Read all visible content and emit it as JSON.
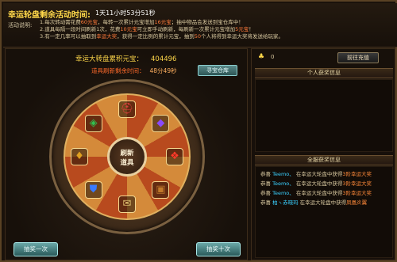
{
  "header": {
    "title": "幸运轮盘剩余活动时间:",
    "countdown": "1天11小时53分51秒",
    "desc_label": "活动说明:",
    "desc_lines": [
      {
        "num": "1.",
        "parts": [
          {
            "t": "每次转动需花费",
            "hl": false
          },
          {
            "t": "60元宝",
            "hl": true
          },
          {
            "t": "，每转一次累计元宝增加",
            "hl": false
          },
          {
            "t": "16元宝",
            "hl": true
          },
          {
            "t": "；抽中物品会发送到宝仓库中！",
            "hl": false
          }
        ]
      },
      {
        "num": "2.",
        "parts": [
          {
            "t": "道具每隔一段时间刷新1次，花费",
            "hl": false
          },
          {
            "t": "10元宝",
            "hl": true
          },
          {
            "t": "可立即手动刷新，每刷新一次累计元宝增加",
            "hl": false
          },
          {
            "t": "5元宝",
            "hl": true
          },
          {
            "t": "！",
            "hl": false
          }
        ]
      },
      {
        "num": "3.",
        "parts": [
          {
            "t": "有一定几率可以抽取到",
            "hl": false
          },
          {
            "t": "幸运大奖",
            "hl": true
          },
          {
            "t": "，获得一定比例的累计元宝，抽到",
            "hl": false
          },
          {
            "t": "50",
            "hl": true
          },
          {
            "t": "个人将得到幸运大奖将发送给玩家。",
            "hl": false
          }
        ]
      }
    ]
  },
  "left": {
    "accum_label": "幸运大转盘累积元宝：",
    "accum_value": "404496",
    "refresh_label": "道具刷新剩余时间：",
    "refresh_value": "48分49秒",
    "store_button": "寻宝仓库",
    "hub_line1": "刷新",
    "hub_line2": "道具",
    "draw_one": "抽奖一次",
    "draw_ten": "抽奖十次",
    "slots": [
      {
        "icon": "helmet-icon",
        "glyph": "⛑",
        "color": "#e84040"
      },
      {
        "icon": "gem-icon",
        "glyph": "◆",
        "color": "#8a4aff"
      },
      {
        "icon": "red-crystal-icon",
        "glyph": "❖",
        "color": "#ff3a2a"
      },
      {
        "icon": "chest-icon",
        "glyph": "▣",
        "color": "#c0782a"
      },
      {
        "icon": "scroll-icon",
        "glyph": "✉",
        "color": "#e0c070"
      },
      {
        "icon": "shield-icon",
        "glyph": "⛊",
        "color": "#3a7aff"
      },
      {
        "icon": "treasure-icon",
        "glyph": "♦",
        "color": "#e0a020"
      },
      {
        "icon": "potion-icon",
        "glyph": "◈",
        "color": "#30c050"
      }
    ]
  },
  "right": {
    "money_value": "0",
    "recharge_button": "前往充值",
    "personal_header": "个人获奖信息",
    "global_header": "全服获奖信息",
    "announcements": [
      {
        "prefix": "恭喜",
        "player": "Teemo、",
        "mid": "在幸运大轮盘中获得",
        "prize": "3阶幸运大奖"
      },
      {
        "prefix": "恭喜",
        "player": "Teemo、",
        "mid": "在幸运大轮盘中获得",
        "prize": "3阶幸运大奖"
      },
      {
        "prefix": "恭喜",
        "player": "Teemo、",
        "mid": "在幸运大轮盘中获得",
        "prize": "3阶幸运大奖"
      },
      {
        "prefix": "恭喜",
        "player": "柏ヽ赤晓玛",
        "mid": "在幸运大轮盘中获得",
        "prize": "凤凰炎翼"
      }
    ]
  }
}
